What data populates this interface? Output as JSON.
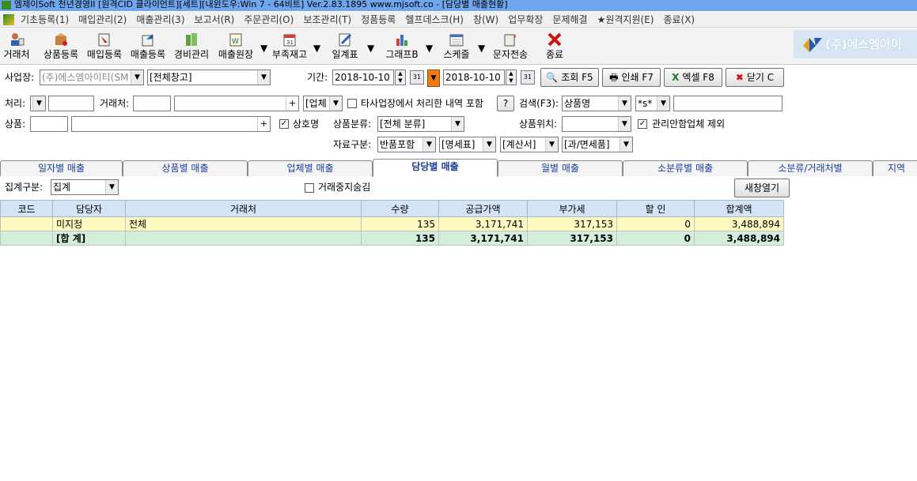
{
  "window": {
    "title": "엠제이Soft 천년경영II [원격CID 클라이언트][세트][내윈도우:Win 7 - 64비트] Ver.2.83.1895           www.mjsoft.co - [담당별 매출현황]"
  },
  "menu": [
    "기초등록(1)",
    "매입관리(2)",
    "매출관리(3)",
    "보고서(R)",
    "주문관리(O)",
    "보조관리(T)",
    "정품등록",
    "헬프데스크(H)",
    "창(W)",
    "업무확장",
    "문제해결",
    "★원격지원(E)",
    "종료(X)"
  ],
  "toolbar": {
    "items": [
      {
        "label": "거래처",
        "icon": "client-icon"
      },
      {
        "label": "상품등록",
        "icon": "product-box-icon"
      },
      {
        "label": "매입등록",
        "icon": "purchase-icon"
      },
      {
        "label": "매출등록",
        "icon": "sales-icon"
      },
      {
        "label": "경비관리",
        "icon": "expense-icon"
      },
      {
        "label": "매출원장",
        "icon": "ledger-icon"
      },
      {
        "label": "부족재고",
        "icon": "calendar-icon"
      },
      {
        "label": "일계표",
        "icon": "pencil-doc-icon"
      },
      {
        "label": "그래프B",
        "icon": "bar-graph-icon"
      },
      {
        "label": "스케줄",
        "icon": "schedule-icon"
      },
      {
        "label": "문자전송",
        "icon": "sms-icon"
      },
      {
        "label": "종료",
        "icon": "exit-icon"
      }
    ],
    "dropdown_mark": "▼"
  },
  "company_logo": {
    "text": "(주)에스엠아이"
  },
  "filters": {
    "workplace_label": "사업장:",
    "workplace_value": "(주)에스엠아이티(SM",
    "warehouse_value": "[전체창고]",
    "period_label": "기간:",
    "date_from": "2018-10-10",
    "date_to": "2018-10-10",
    "search_btn": "조회 F5",
    "print_btn": "인쇄 F7",
    "excel_btn": "엑셀 F8",
    "close_btn": "닫기 C",
    "process_label": "처리:",
    "client_label": "거래처:",
    "plus": "+",
    "biz_type_value": "[업체",
    "other_workplace_label": "타사업장에서 처리한 내역 포함",
    "help_q": "?",
    "search_label": "검색(F3):",
    "search_field_value": "상품명",
    "search_mode_value": "*s*",
    "product_label": "상품:",
    "product_name_label": "상호명",
    "category_label": "상품분류:",
    "category_value": "[전체 분류]",
    "location_label": "상품위치:",
    "exclude_label": "관리안함업체 제외",
    "data_type_label": "자료구분:",
    "return_value": "반품포함",
    "statement_value": "[명세표]",
    "invoice_value": "[계산서]",
    "tax_value": "[과/면세품]"
  },
  "tabs": [
    "일자별 매출",
    "상품별 매출",
    "업체별 매출",
    "담당별 매출",
    "월별 매출",
    "소분류별 매출",
    "소분류/거래처별",
    "지역"
  ],
  "active_tab": "담당별 매출",
  "options": {
    "group_label": "집계구분:",
    "group_value": "집계",
    "hide_suspended_label": "거래중지숨김",
    "new_window_btn": "새창열기"
  },
  "grid": {
    "columns": [
      "코드",
      "담당자",
      "거래처",
      "수량",
      "공급가액",
      "부가세",
      "할 인",
      "합계액"
    ],
    "rows": [
      {
        "code": "",
        "manager": "미지정",
        "client": "전체",
        "qty": "135",
        "supply": "3,171,741",
        "vat": "317,153",
        "discount": "0",
        "total": "3,488,894"
      }
    ],
    "total_row": {
      "code": "",
      "manager": "[합 계]",
      "client": "",
      "qty": "135",
      "supply": "3,171,741",
      "vat": "317,153",
      "discount": "0",
      "total": "3,488,894"
    }
  }
}
